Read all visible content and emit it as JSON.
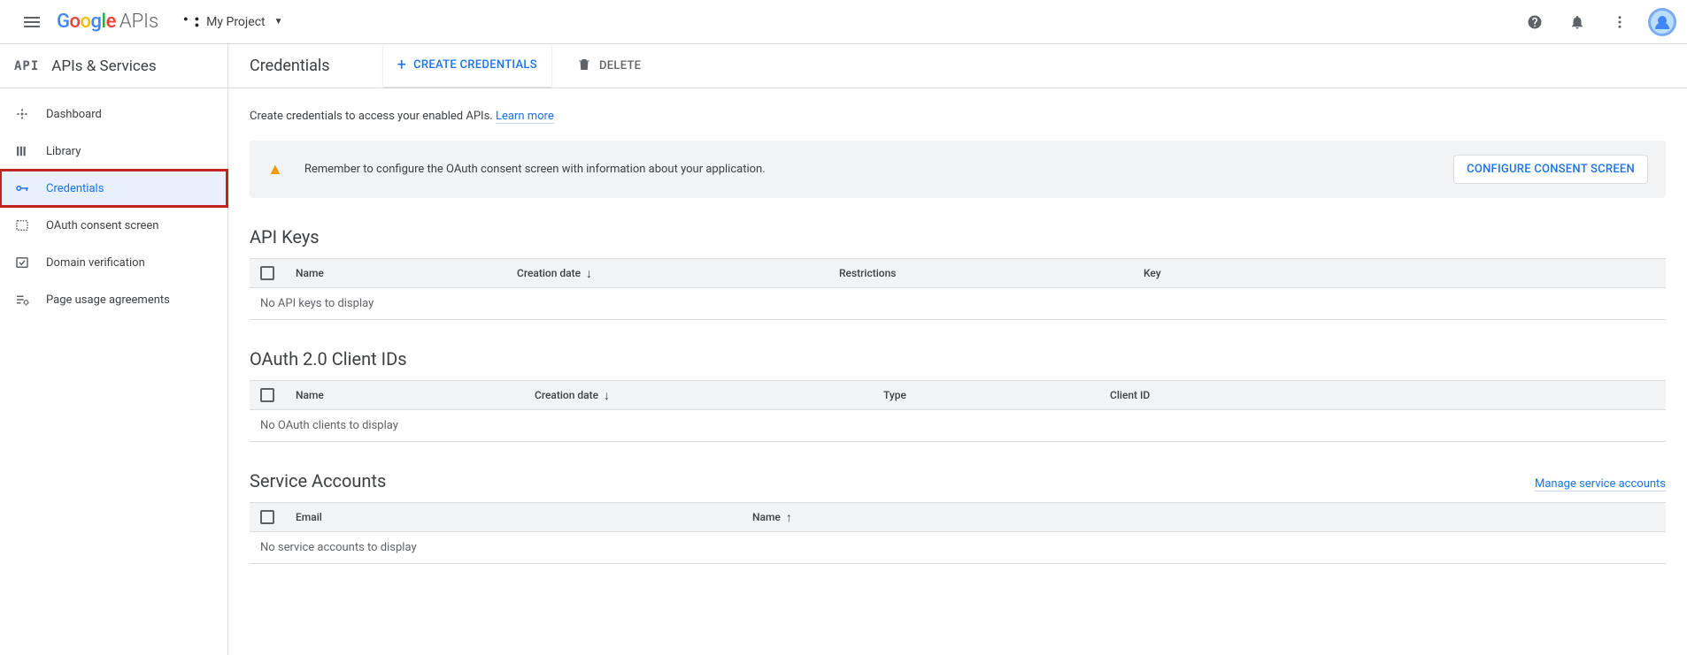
{
  "header": {
    "logo_suffix": "APIs",
    "project_name": "My Project"
  },
  "sidebar": {
    "badge": "API",
    "title": "APIs & Services",
    "items": [
      {
        "label": "Dashboard"
      },
      {
        "label": "Library"
      },
      {
        "label": "Credentials"
      },
      {
        "label": "OAuth consent screen"
      },
      {
        "label": "Domain verification"
      },
      {
        "label": "Page usage agreements"
      }
    ]
  },
  "page": {
    "title": "Credentials",
    "create_btn": "CREATE CREDENTIALS",
    "delete_btn": "DELETE",
    "intro": "Create credentials to access your enabled APIs.",
    "learn_more": "Learn more"
  },
  "alert": {
    "text": "Remember to configure the OAuth consent screen with information about your application.",
    "button": "CONFIGURE CONSENT SCREEN"
  },
  "sections": {
    "api_keys": {
      "title": "API Keys",
      "cols": {
        "name": "Name",
        "date": "Creation date",
        "restrictions": "Restrictions",
        "key": "Key"
      },
      "empty": "No API keys to display"
    },
    "oauth": {
      "title": "OAuth 2.0 Client IDs",
      "cols": {
        "name": "Name",
        "date": "Creation date",
        "type": "Type",
        "client": "Client ID"
      },
      "empty": "No OAuth clients to display"
    },
    "service": {
      "title": "Service Accounts",
      "manage": "Manage service accounts",
      "cols": {
        "email": "Email",
        "name": "Name"
      },
      "empty": "No service accounts to display"
    }
  }
}
